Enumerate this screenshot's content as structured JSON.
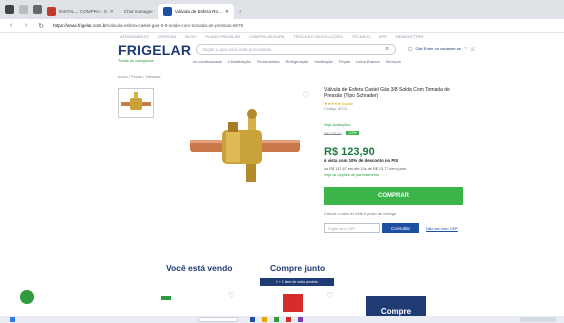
{
  "browser": {
    "tabs": [
      {
        "label": "INSTAL... COMPRA - S",
        "icon_color": "#c0392b"
      },
      {
        "label": "Chat manager",
        "icon_color": "#888888"
      },
      {
        "label": "Válvula de Esfera Ro...",
        "icon_color": "#1f4fa0",
        "active": true
      },
      {
        "label": "+",
        "icon_color": ""
      }
    ],
    "url_host": "https://www.frigelar.com.br",
    "url_path": "/valvula-esfera-castel-gas-3-8-solda-com-tomada-de-pressao-6078"
  },
  "site": {
    "top_links": [
      "ATENDIMENTO",
      "OFERTAS",
      "BLOG",
      "PLANO FRIGELAR",
      "COMPRA SEGURA",
      "TROCAS E DEVOLUÇÕES",
      "TÉCNICO",
      "APP",
      "NEWSLETTER",
      "CADASTRE-SE",
      "FRETE GRÁTIS"
    ],
    "logo": "FRIGELAR",
    "sublogo": "Todas as categorias",
    "search_placeholder": "Digite o que você está procurando",
    "login_label": "Olá! Entre ou cadastre-se",
    "categories": [
      "Ar-condicionado",
      "Climatização",
      "Ferramentas",
      "Refrigeração",
      "Ventilação",
      "Peças",
      "Linha Branca",
      "Serviços",
      "Climatizadores"
    ],
    "breadcrumb": "Início / Peças / Válvulas"
  },
  "product": {
    "title": "Válvula de Esfera Castel Gás 3/8 Solda Com Tomada de Pressão (Tipo Schrader)",
    "sku": "Código: 6078",
    "rating_text": "★★★★★ Avaliar",
    "reviews": "Veja avaliações",
    "old_price": "R$ 175,00",
    "discount_badge": "-29%",
    "price": "R$ 123,90",
    "pix_text": "à vista com 10% de desconto no PIX",
    "installments": "ou R$ 137,67 em até 10x de R$ 13,77 sem juros",
    "installments_link": "Veja as opções de parcelamento",
    "buy_label": "COMPRAR",
    "shipping_label": "Calcule o valor do frete e prazo de entrega",
    "cep_placeholder": "Digite seu CEP",
    "cep_button": "Consultar",
    "cep_link": "Não sei meu CEP"
  },
  "sections": {
    "viewing": "Você está vendo",
    "buy_together": "Compre junto",
    "buy_together_bar": "1 + 1 item de outro produto",
    "compre_btn": "Compre"
  }
}
